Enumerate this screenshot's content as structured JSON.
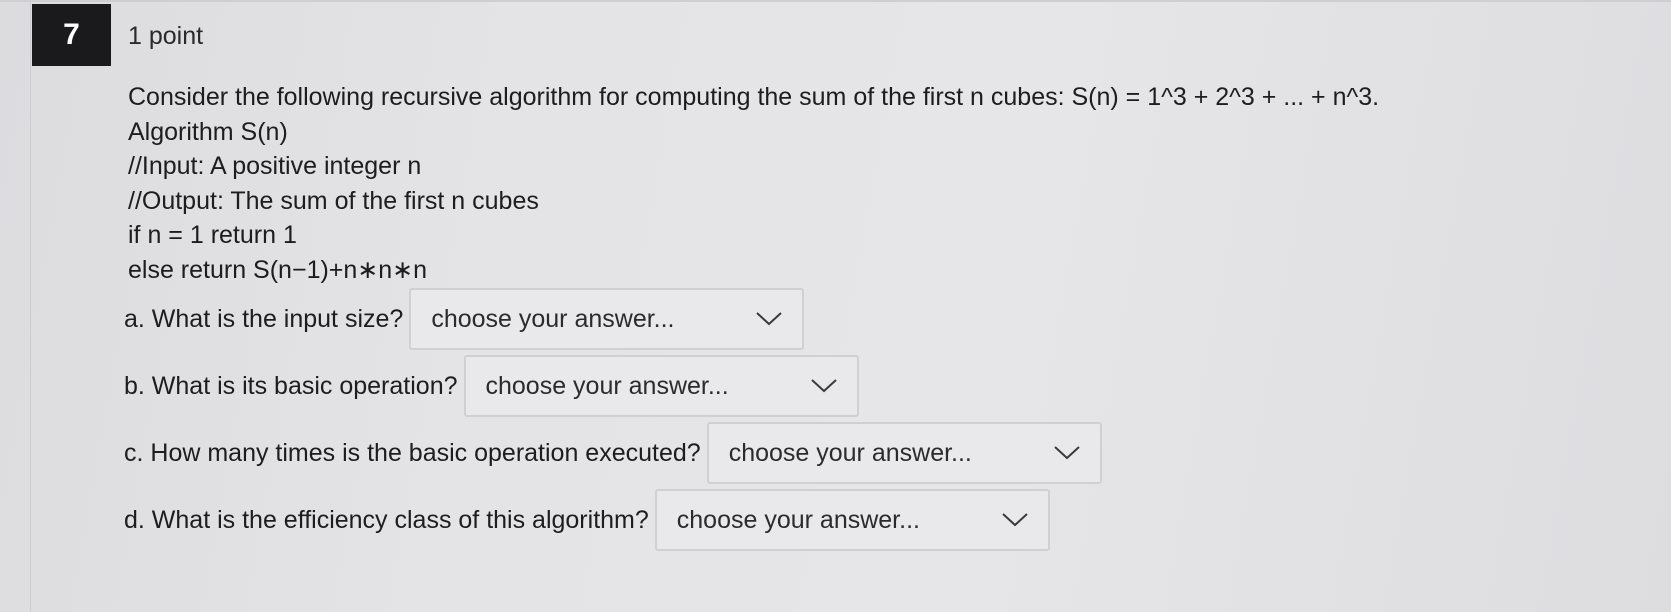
{
  "question": {
    "number": "7",
    "points": "1 point",
    "stem": [
      "Consider the following recursive algorithm for computing the sum of the first n cubes: S(n) = 1^3 + 2^3 + ... + n^3.",
      "Algorithm S(n)",
      "//Input: A positive integer n",
      "//Output: The sum of the first n cubes",
      "if n = 1 return 1",
      "else return S(n−1)+n∗n∗n"
    ]
  },
  "subquestions": [
    {
      "label": "a. What is the input size?",
      "selected": "choose your answer..."
    },
    {
      "label": "b. What is its basic operation?",
      "selected": "choose your answer..."
    },
    {
      "label": "c. How many times is the basic operation executed?",
      "selected": "choose your answer..."
    },
    {
      "label": "d. What is the efficiency class of this algorithm?",
      "selected": "choose your answer..."
    }
  ],
  "icons": {
    "dropdown": "chevron-down-icon"
  }
}
